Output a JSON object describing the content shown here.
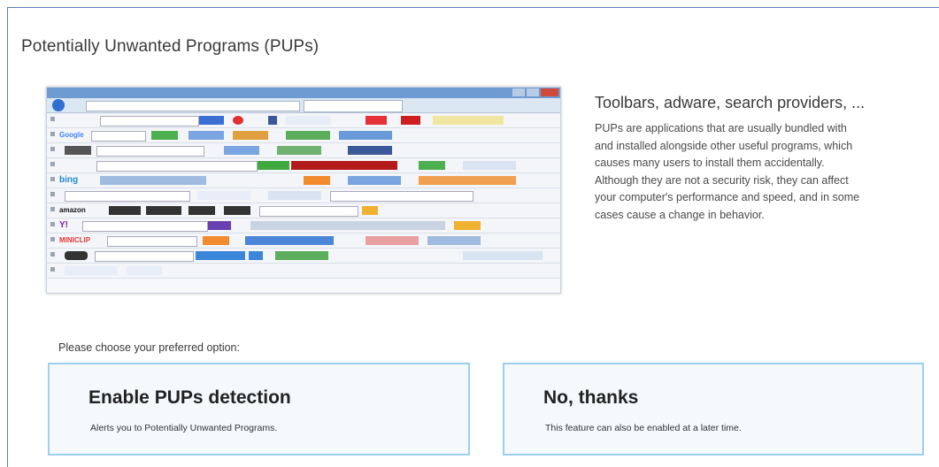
{
  "page": {
    "title": "Potentially Unwanted Programs (PUPs)"
  },
  "illustration": {
    "description_icon": "browser-toolbars-screenshot",
    "toolbar_labels": [
      "Google",
      "bing",
      "amazon",
      "Y!",
      "MINICLIP"
    ]
  },
  "info": {
    "heading": "Toolbars, adware, search providers, ...",
    "body_lines": [
      "PUPs are applications that are usually bundled with",
      "and installed alongside other useful programs, which",
      "causes many users to install them accidentally.",
      "Although they are not a security risk, they can affect",
      "your computer's performance and speed, and in some",
      "cases cause a change in behavior."
    ]
  },
  "choice": {
    "prompt": "Please choose your preferred option:",
    "options": [
      {
        "title": "Enable PUPs detection",
        "subtitle": "Alerts you to Potentially Unwanted Programs."
      },
      {
        "title": "No, thanks",
        "subtitle": "This feature can also be enabled at a later time."
      }
    ]
  },
  "colors": {
    "option_border": "#9cd0ee",
    "option_bg": "#f5f9fc",
    "frame_border": "#5a7fb5"
  }
}
